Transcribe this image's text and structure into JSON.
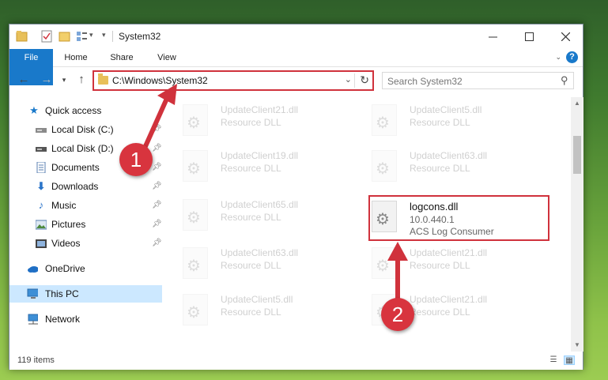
{
  "window": {
    "title": "System32"
  },
  "ribbon": {
    "tabs": [
      "File",
      "Home",
      "Share",
      "View"
    ],
    "help_label": "?"
  },
  "address": {
    "path": "C:\\Windows\\System32"
  },
  "search": {
    "placeholder": "Search System32"
  },
  "sidebar": {
    "items": [
      {
        "label": "Quick access",
        "icon": "star-icon"
      },
      {
        "label": "Local Disk (C:)",
        "icon": "drive-icon"
      },
      {
        "label": "Local Disk (D:)",
        "icon": "drive-icon"
      },
      {
        "label": "Documents",
        "icon": "documents-icon"
      },
      {
        "label": "Downloads",
        "icon": "download-icon"
      },
      {
        "label": "Music",
        "icon": "music-icon"
      },
      {
        "label": "Pictures",
        "icon": "pictures-icon"
      },
      {
        "label": "Videos",
        "icon": "videos-icon"
      },
      {
        "label": "OneDrive",
        "icon": "cloud-icon"
      },
      {
        "label": "This PC",
        "icon": "computer-icon"
      },
      {
        "label": "Network",
        "icon": "network-icon"
      }
    ]
  },
  "files": {
    "left": [
      {
        "name": "UpdateClient21.dll",
        "type": "Resource DLL"
      },
      {
        "name": "UpdateClient19.dll",
        "type": "Resource DLL"
      },
      {
        "name": "UpdateClient65.dll",
        "type": "Resource DLL"
      },
      {
        "name": "UpdateClient63.dll",
        "type": "Resource DLL"
      },
      {
        "name": "UpdateClient5.dll",
        "type": "Resource DLL"
      }
    ],
    "right": [
      {
        "name": "UpdateClient5.dll",
        "type": "Resource DLL"
      },
      {
        "name": "UpdateClient63.dll",
        "type": "Resource DLL"
      },
      {
        "name": "UpdateClient21.dll",
        "type": "Resource DLL"
      },
      {
        "name": "UpdateClient21.dll",
        "type": "Resource DLL"
      }
    ],
    "highlighted": {
      "name": "logcons.dll",
      "version": "10.0.440.1",
      "description": "ACS Log Consumer"
    }
  },
  "status": {
    "item_count": "119 items"
  },
  "annotations": {
    "step1": "1",
    "step2": "2",
    "color": "#d0323c"
  }
}
